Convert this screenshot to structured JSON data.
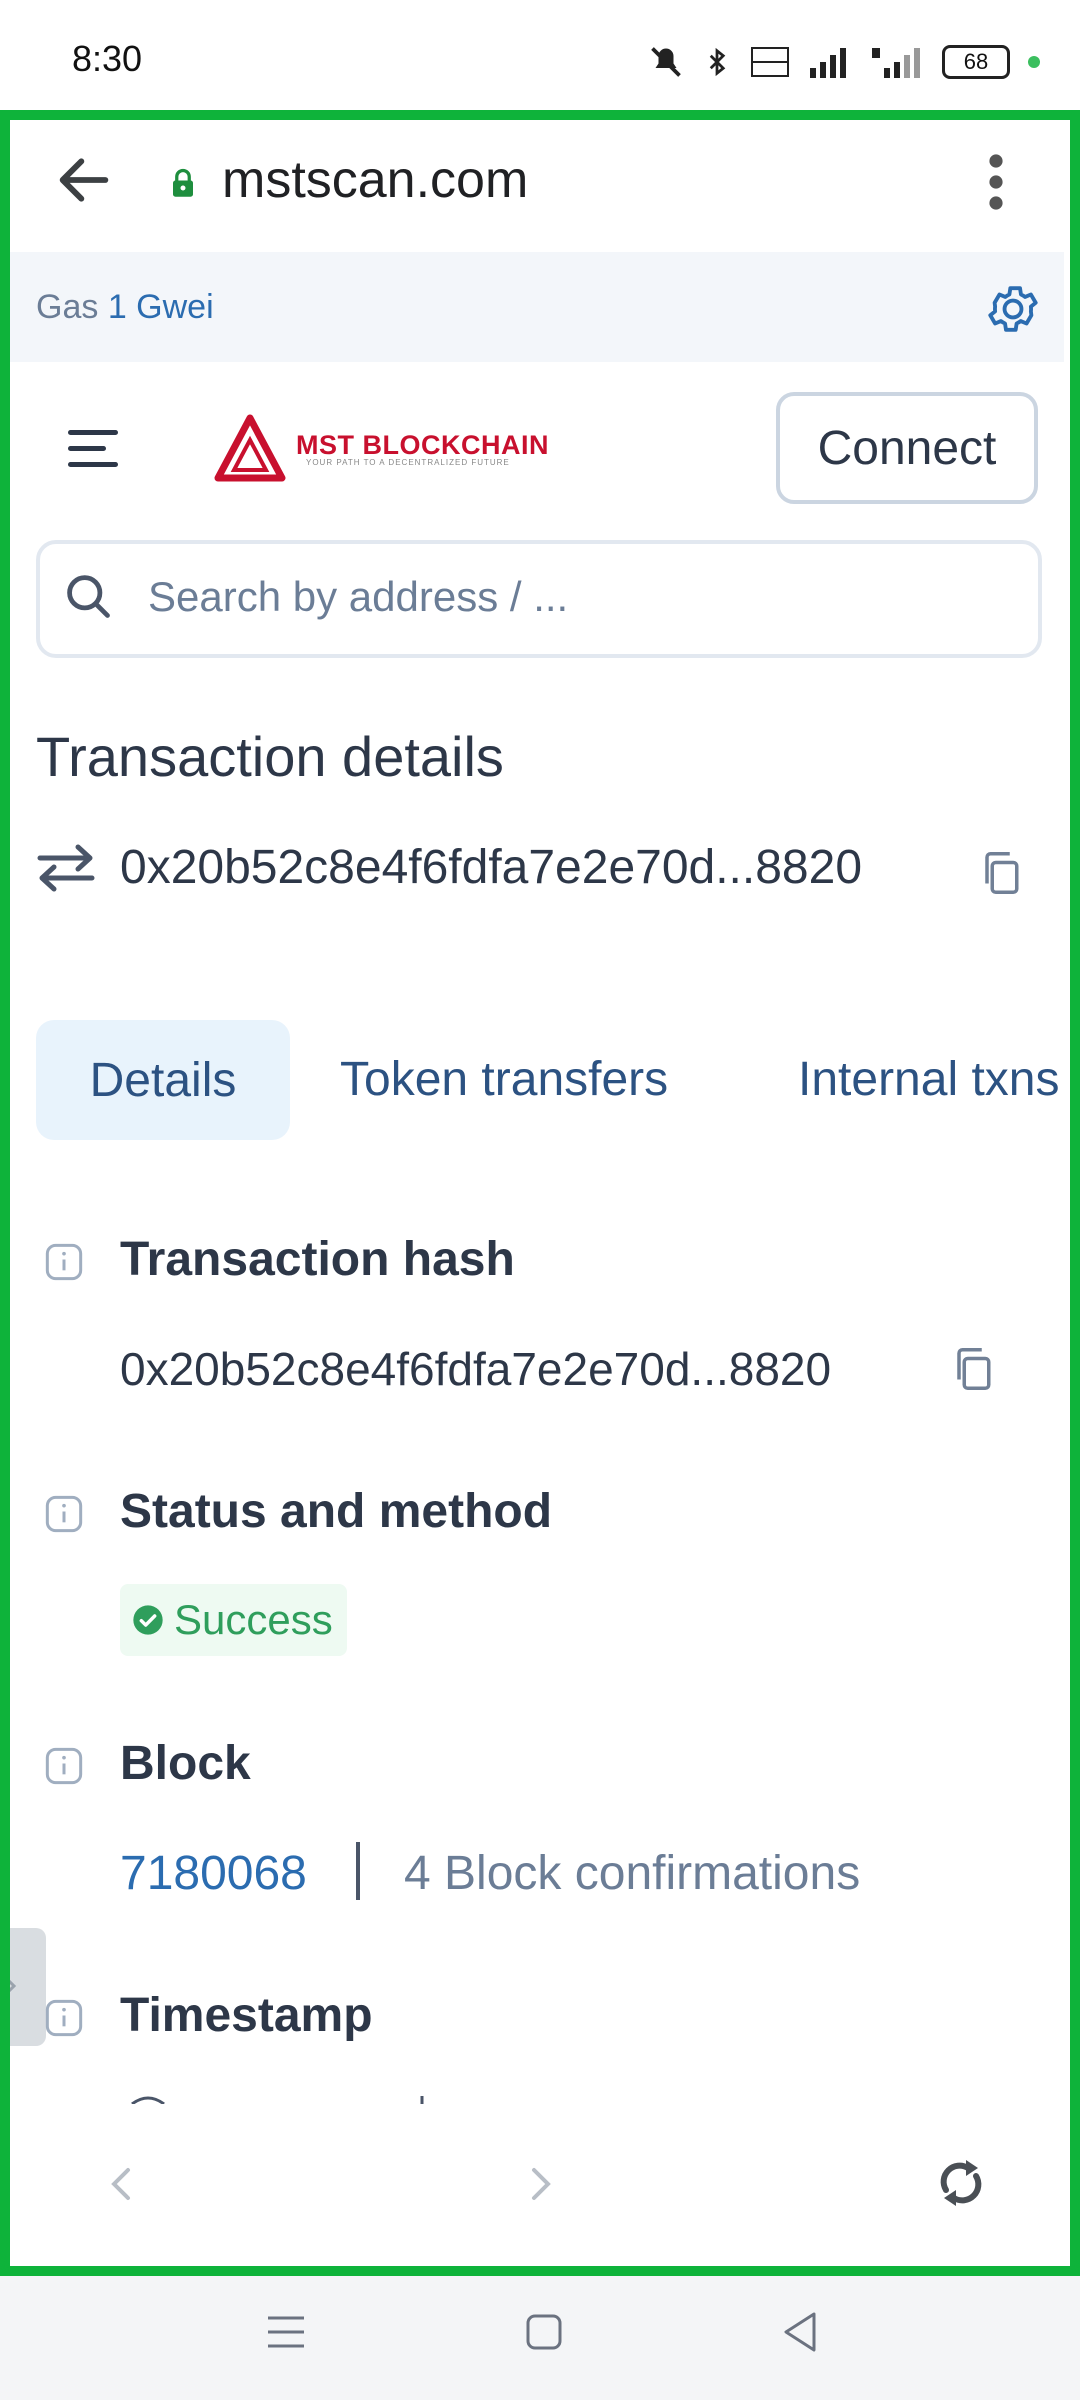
{
  "status_bar": {
    "time": "8:30",
    "battery": "68"
  },
  "browser": {
    "url": "mstscan.com"
  },
  "gas": {
    "label": "Gas",
    "value": "1 Gwei"
  },
  "header": {
    "logo_title": "MST BLOCKCHAIN",
    "logo_subtitle": "YOUR PATH TO A DECENTRALIZED FUTURE",
    "connect_label": "Connect"
  },
  "search": {
    "placeholder": "Search by address / ..."
  },
  "page": {
    "title": "Transaction details",
    "tx_hash_short": "0x20b52c8e4f6fdfa7e2e70d...8820"
  },
  "tabs": [
    {
      "label": "Details",
      "active": true
    },
    {
      "label": "Token transfers",
      "active": false
    },
    {
      "label": "Internal txns",
      "active": false
    }
  ],
  "details": {
    "tx_hash": {
      "label": "Transaction hash",
      "value": "0x20b52c8e4f6fdfa7e2e70d...8820"
    },
    "status": {
      "label": "Status and method",
      "value": "Success"
    },
    "block": {
      "label": "Block",
      "number": "7180068",
      "confirmations": "4 Block confirmations"
    },
    "timestamp": {
      "label": "Timestamp"
    }
  },
  "colors": {
    "frame": "#0eb33a",
    "link": "#2b6cb0",
    "success": "#2f9e5c",
    "brand": "#c8102e"
  }
}
